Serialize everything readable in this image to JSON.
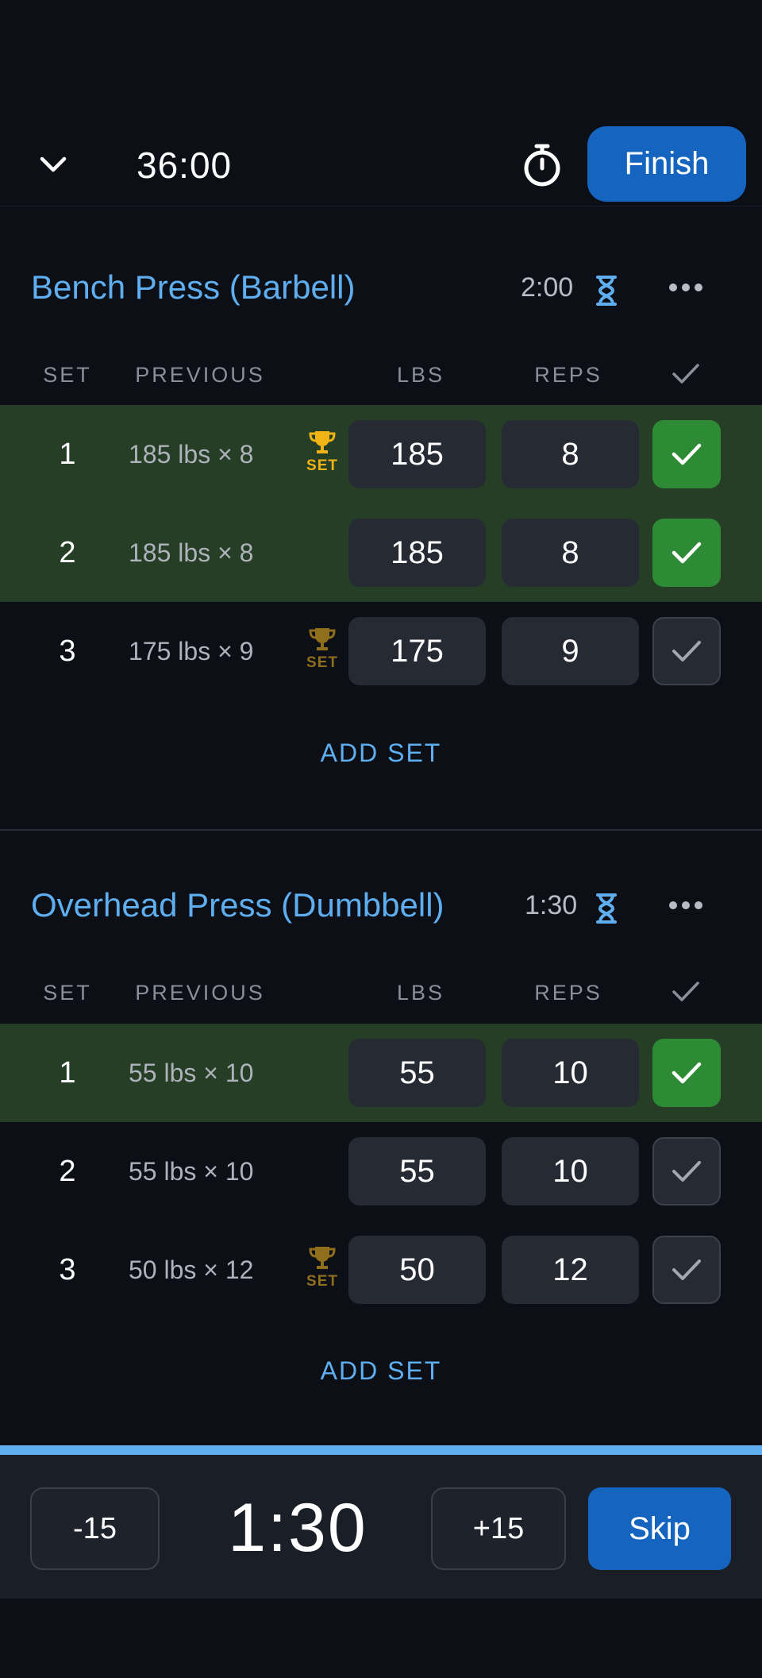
{
  "header": {
    "elapsed_time": "36:00",
    "finish_label": "Finish",
    "collapse_icon": "chevron-down-icon",
    "stopwatch_icon": "stopwatch-icon"
  },
  "columns": {
    "set": "SET",
    "previous": "PREVIOUS",
    "lbs": "LBS",
    "reps": "REPS"
  },
  "exercises": [
    {
      "name": "Bench Press (Barbell)",
      "rest_time": "2:00",
      "add_set_label": "ADD SET",
      "sets": [
        {
          "set": "1",
          "previous": "185 lbs × 8",
          "lbs": "185",
          "reps": "8",
          "completed": true,
          "record": true,
          "record_label": "SET"
        },
        {
          "set": "2",
          "previous": "185 lbs × 8",
          "lbs": "185",
          "reps": "8",
          "completed": true,
          "record": false
        },
        {
          "set": "3",
          "previous": "175 lbs × 9",
          "lbs": "175",
          "reps": "9",
          "completed": false,
          "record": true,
          "record_label": "SET"
        }
      ]
    },
    {
      "name": "Overhead Press (Dumbbell)",
      "rest_time": "1:30",
      "add_set_label": "ADD SET",
      "sets": [
        {
          "set": "1",
          "previous": "55 lbs × 10",
          "lbs": "55",
          "reps": "10",
          "completed": true,
          "record": false
        },
        {
          "set": "2",
          "previous": "55 lbs × 10",
          "lbs": "55",
          "reps": "10",
          "completed": false,
          "record": false
        },
        {
          "set": "3",
          "previous": "50 lbs × 12",
          "lbs": "50",
          "reps": "12",
          "completed": false,
          "record": true,
          "record_label": "SET"
        }
      ]
    }
  ],
  "rest_timer": {
    "minus_label": "-15",
    "remaining": "1:30",
    "plus_label": "+15",
    "skip_label": "Skip",
    "progress": 1.0
  },
  "colors": {
    "accent": "#5eaef0",
    "primary_button": "#1565c0",
    "completed_row": "#263d26",
    "completed_check": "#2e8b35",
    "record_gold": "#f0b416"
  }
}
